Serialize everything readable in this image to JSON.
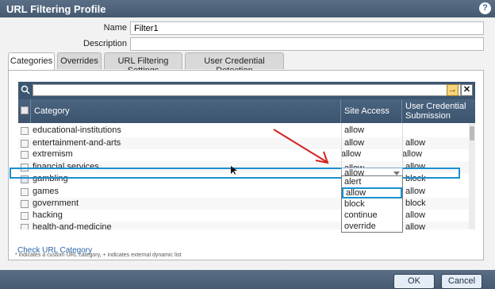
{
  "window": {
    "title": "URL Filtering Profile",
    "help_icon": "?"
  },
  "form": {
    "name_label": "Name",
    "name_value": "Filter1",
    "description_label": "Description",
    "description_value": ""
  },
  "tabs": [
    {
      "label": "Categories",
      "active": true
    },
    {
      "label": "Overrides",
      "active": false
    },
    {
      "label": "URL Filtering Settings",
      "active": false
    },
    {
      "label": "User Credential Detection",
      "active": false
    }
  ],
  "toolbar": {
    "go_icon": "→",
    "clear_icon": "✕"
  },
  "grid": {
    "columns": {
      "category": "Category",
      "site_access": "Site Access",
      "user_cred_line1": "User Credential",
      "user_cred_line2": "Submission"
    },
    "rows": [
      {
        "category": "educational-institutions",
        "site_access": "allow",
        "user_cred": ""
      },
      {
        "category": "entertainment-and-arts",
        "site_access": "allow",
        "user_cred": "allow"
      },
      {
        "category": "extremism",
        "site_access": "allow",
        "user_cred": "allow"
      },
      {
        "category": "financial services",
        "site_access": "allow",
        "user_cred": "allow"
      },
      {
        "category": "gambling",
        "site_access": "allow",
        "user_cred": "block"
      },
      {
        "category": "games",
        "site_access": "",
        "user_cred": "allow"
      },
      {
        "category": "government",
        "site_access": "",
        "user_cred": "block"
      },
      {
        "category": "hacking",
        "site_access": "",
        "user_cred": "allow"
      },
      {
        "category": "health-and-medicine",
        "site_access": "",
        "user_cred": "allow"
      }
    ]
  },
  "dropdown": {
    "current": "allow",
    "options": [
      "alert",
      "allow",
      "block",
      "continue",
      "override"
    ],
    "selected": "allow"
  },
  "note": "* indicates a custom URL category, + indicates external dynamic list",
  "check_link": "Check URL Category",
  "buttons": {
    "ok": "OK",
    "cancel": "Cancel"
  },
  "colors": {
    "header": "#3d5670",
    "highlight": "#1a8fd0",
    "arrow": "#d62020"
  }
}
